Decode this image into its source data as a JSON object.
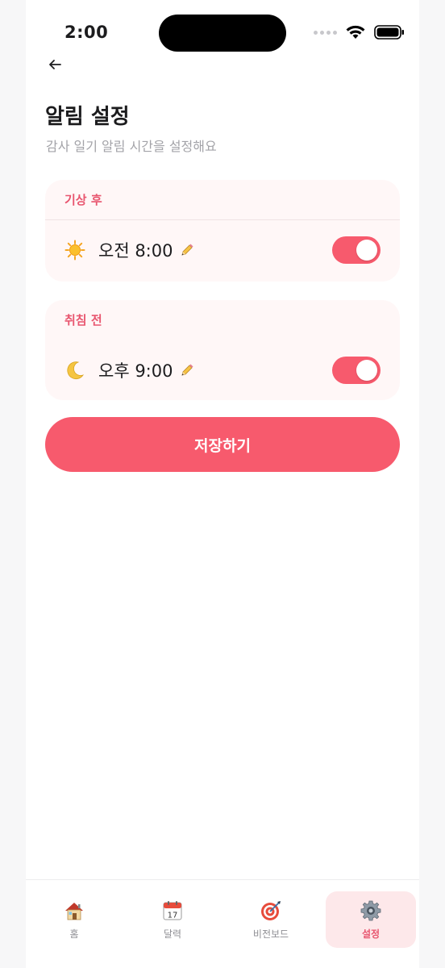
{
  "status_bar": {
    "time": "2:00"
  },
  "header": {
    "title": "알림 설정",
    "subtitle": "감사 일기 알림 시간을 설정해요"
  },
  "alarms": [
    {
      "section": "기상 후",
      "icon": "sun-icon",
      "time": "오전 8:00",
      "enabled": true
    },
    {
      "section": "취침 전",
      "icon": "moon-icon",
      "time": "오후 9:00",
      "enabled": true
    }
  ],
  "save_label": "저장하기",
  "tabs": [
    {
      "label": "홈",
      "icon": "house-icon",
      "active": false
    },
    {
      "label": "달력",
      "icon": "calendar-icon",
      "active": false
    },
    {
      "label": "비전보드",
      "icon": "target-icon",
      "active": false
    },
    {
      "label": "설정",
      "icon": "gear-icon",
      "active": true
    }
  ],
  "colors": {
    "accent": "#f75a6d",
    "accent_text": "#e8566f",
    "card_bg": "#fff7f7",
    "active_tab_bg": "#fde8ea"
  }
}
